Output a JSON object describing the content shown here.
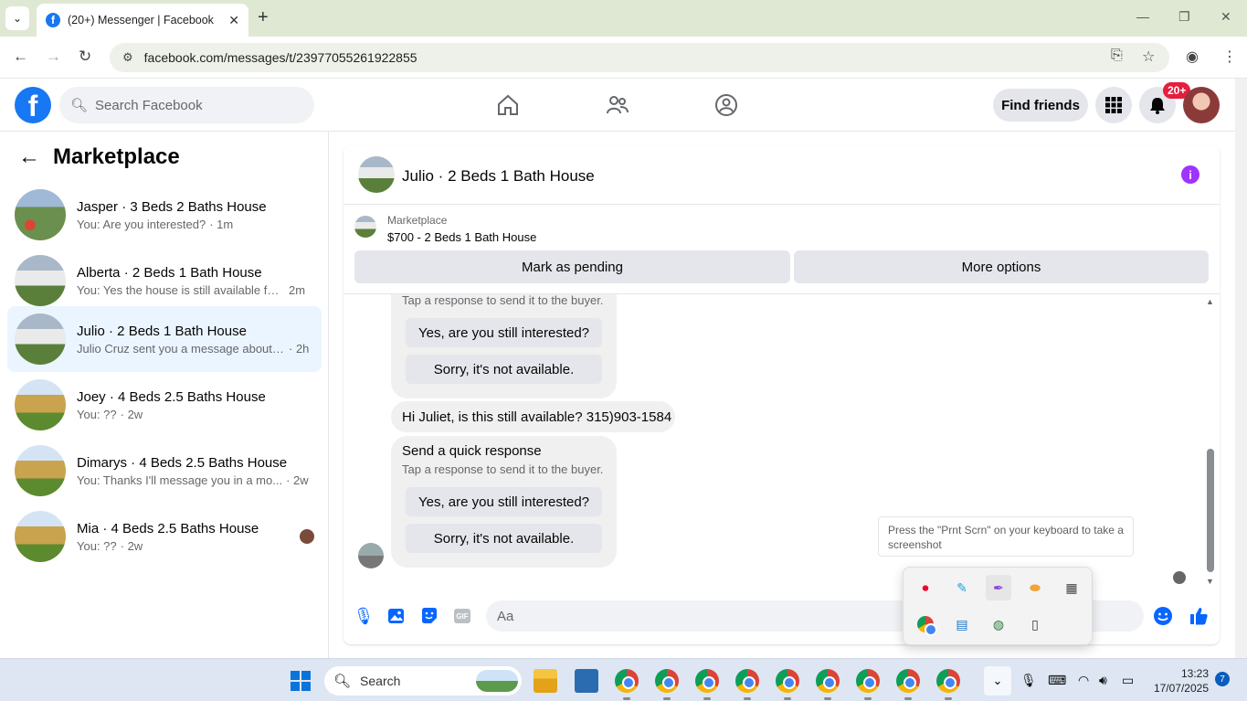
{
  "browser": {
    "tab_title": "(20+) Messenger | Facebook",
    "url": "facebook.com/messages/t/23977055261922855"
  },
  "header": {
    "search_placeholder": "Search Facebook",
    "find_friends": "Find friends",
    "notification_count": "20+"
  },
  "sidebar": {
    "title": "Marketplace",
    "conversations": [
      {
        "name": "Jasper · 3 Beds 2 Baths House",
        "message": "You: Are you interested?",
        "time": "· 1m"
      },
      {
        "name": "Alberta · 2 Beds 1 Bath House",
        "message": "You: Yes the house is still available for...",
        "time": "2m"
      },
      {
        "name": "Julio · 2 Beds 1 Bath House",
        "message": "Julio Cruz sent you a message about ...",
        "time": "· 2h"
      },
      {
        "name": "Joey · 4 Beds 2.5 Baths House",
        "message": "You: ??",
        "time": "· 2w"
      },
      {
        "name": "Dimarys · 4 Beds 2.5 Baths House",
        "message": "You: Thanks I'll message you in a mo...",
        "time": "· 2w"
      },
      {
        "name": "Mia · 4 Beds 2.5 Baths House",
        "message": "You: ??",
        "time": "· 2w"
      }
    ]
  },
  "chat": {
    "title": "Julio · 2 Beds 1 Bath House",
    "listing_label": "Marketplace",
    "listing_price": "$700 - 2 Beds 1 Bath House",
    "mark_pending": "Mark as pending",
    "more_options": "More options",
    "quick_response_hint": "Tap a response to send it to the buyer.",
    "quick_response_title": "Send a quick response",
    "reply_yes": "Yes, are you still interested?",
    "reply_no": "Sorry, it's not available.",
    "buyer_message": "Hi Juliet, is this still available? 315)903-1584",
    "composer_placeholder": "Aa"
  },
  "overlay": {
    "tooltip": "Press the \"Prnt Scrn\" on your keyboard to take a screenshot"
  },
  "taskbar": {
    "search_label": "Search",
    "time": "13:23",
    "date": "17/07/2025",
    "notification_count": "7"
  },
  "colors": {
    "facebook_blue": "#1877f2",
    "messenger_blue": "#0866ff",
    "active_conversation": "#ebf5ff",
    "notification_red": "#e41e3f"
  }
}
